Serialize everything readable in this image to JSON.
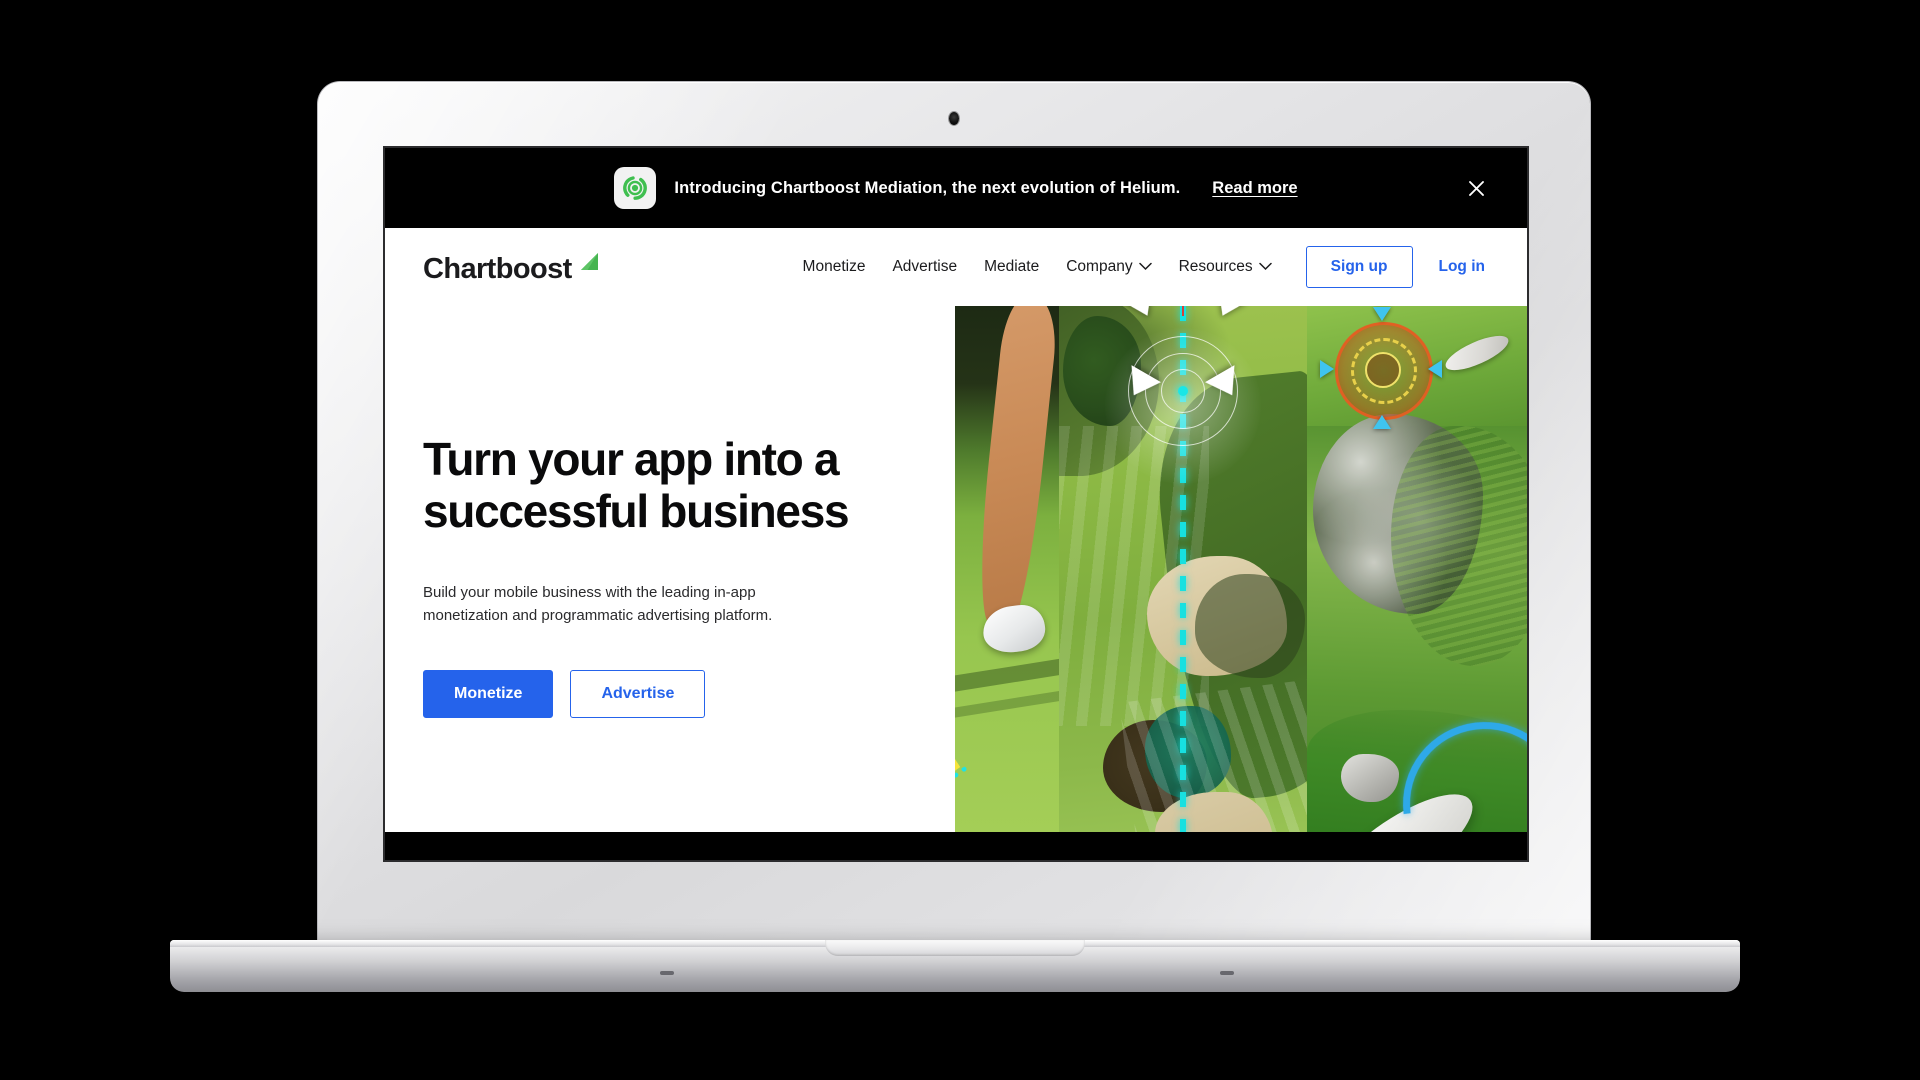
{
  "device": {
    "model_label": "MacBook Air"
  },
  "announcement": {
    "icon": "chartboost-app-icon",
    "message": "Introducing Chartboost Mediation, the next evolution of Helium.",
    "read_more_label": "Read more",
    "close_icon": "close-icon",
    "background_color": "#000000",
    "text_color": "#ffffff"
  },
  "header": {
    "brand": {
      "wordmark": "Chartboost",
      "mark_icon": "chartboost-leaf-icon",
      "mark_color": "#46b450"
    },
    "nav": [
      {
        "label": "Monetize",
        "has_dropdown": false
      },
      {
        "label": "Advertise",
        "has_dropdown": false
      },
      {
        "label": "Mediate",
        "has_dropdown": false
      },
      {
        "label": "Company",
        "has_dropdown": true
      },
      {
        "label": "Resources",
        "has_dropdown": true
      }
    ],
    "signup_label": "Sign up",
    "login_label": "Log in",
    "accent_color": "#2563eb"
  },
  "hero": {
    "headline": "Turn your app into a successful business",
    "subtext": "Build your mobile business with the leading in-app monetization and programmatic advertising platform.",
    "cta_primary": "Monetize",
    "cta_secondary": "Advertise",
    "artwork": {
      "description": "Three vertical golf game panels",
      "panels": [
        "golfer-shoe-on-fairway",
        "overhead-golf-course-with-aim-line",
        "target-reticle-over-rocky-terrain"
      ],
      "hud_colors": {
        "aim_line": "#17e0e0",
        "reticle_outer": "#e46024",
        "reticle_inner": "#f0e26a",
        "caret": "#3fc4ef",
        "yellow_arc": "#f5e43a",
        "blue_arc": "#2ea9e8"
      }
    }
  }
}
